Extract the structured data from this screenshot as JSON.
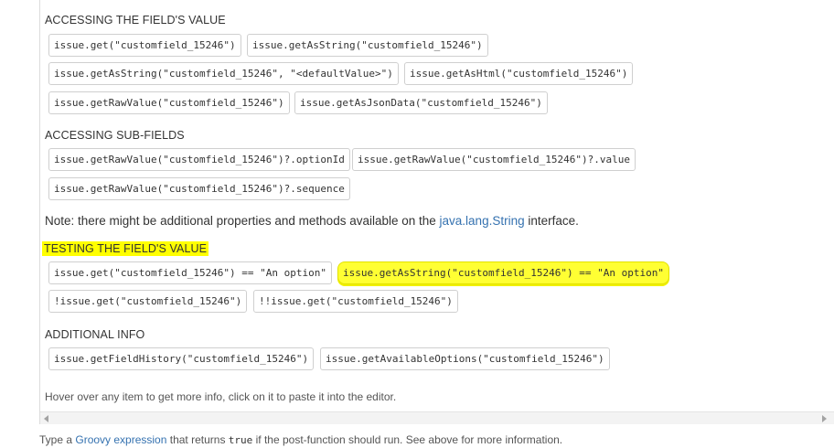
{
  "sections": {
    "accessing_value": {
      "title": "ACCESSING THE FIELD'S VALUE",
      "items": [
        "issue.get(\"customfield_15246\")",
        "issue.getAsString(\"customfield_15246\")",
        "issue.getAsString(\"customfield_15246\", \"<defaultValue>\")",
        "issue.getAsHtml(\"customfield_15246\")",
        "issue.getRawValue(\"customfield_15246\")",
        "issue.getAsJsonData(\"customfield_15246\")"
      ]
    },
    "sub_fields": {
      "title": "ACCESSING SUB-FIELDS",
      "items": [
        "issue.getRawValue(\"customfield_15246\")?.optionId",
        "issue.getRawValue(\"customfield_15246\")?.value",
        "issue.getRawValue(\"customfield_15246\")?.sequence"
      ]
    },
    "note": {
      "prefix": "Note: there might be additional properties and methods available on the ",
      "link": "java.lang.String",
      "suffix": " interface."
    },
    "testing_value": {
      "title": "TESTING THE FIELD'S VALUE",
      "items": [
        "issue.get(\"customfield_15246\") == \"An option\"",
        "issue.getAsString(\"customfield_15246\") == \"An option\"",
        "!issue.get(\"customfield_15246\")",
        "!!issue.get(\"customfield_15246\")"
      ]
    },
    "additional_info": {
      "title": "ADDITIONAL INFO",
      "items": [
        "issue.getFieldHistory(\"customfield_15246\")",
        "issue.getAvailableOptions(\"customfield_15246\")"
      ]
    }
  },
  "hover_hint": "Hover over any item to get more info, click on it to paste it into the editor.",
  "footer": {
    "prefix": "Type a ",
    "link": "Groovy expression",
    "middle": " that returns ",
    "code": "true",
    "suffix": " if the post-function should run. See above for more information."
  },
  "colors": {
    "highlight": "#ffff00",
    "link": "#3572b0"
  }
}
